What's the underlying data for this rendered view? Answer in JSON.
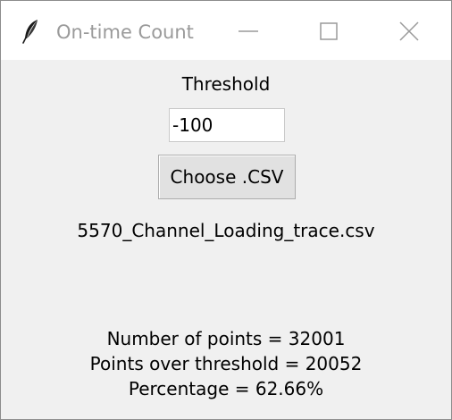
{
  "window": {
    "title": "On-time Count",
    "icon": "feather-icon",
    "controls": {
      "minimize_icon": "minimize-icon",
      "maximize_icon": "maximize-icon",
      "close_icon": "close-icon"
    }
  },
  "form": {
    "threshold_label": "Threshold",
    "threshold_value": "-100",
    "choose_button_label": "Choose .CSV",
    "selected_file": "5570_Channel_Loading_trace.csv"
  },
  "results": {
    "number_of_points": "Number of points = 32001",
    "points_over_threshold": "Points over threshold = 20052",
    "percentage": "Percentage = 62.66%"
  }
}
